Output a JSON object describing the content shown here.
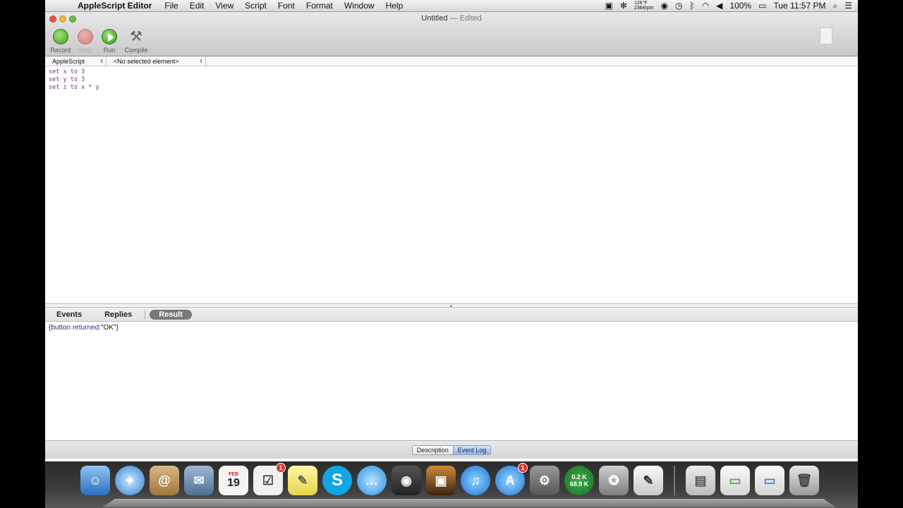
{
  "menubar": {
    "app_name": "AppleScript Editor",
    "menus": [
      "File",
      "Edit",
      "View",
      "Script",
      "Font",
      "Format",
      "Window",
      "Help"
    ],
    "temp_top": "126°F",
    "temp_bottom": "2364rpm",
    "battery": "100%",
    "clock": "Tue 11:57 PM"
  },
  "window": {
    "title": "Untitled",
    "title_suffix": "— Edited"
  },
  "toolbar": {
    "record_label": "Record",
    "stop_label": "Stop",
    "run_label": "Run",
    "compile_label": "Compile",
    "bundle_label": "Bundle Contents"
  },
  "navbar": {
    "language": "AppleScript",
    "element": "<No selected element>"
  },
  "editor": {
    "lines": [
      "set x to 3",
      "set y to 3",
      "set z to x * y"
    ]
  },
  "log_tabs": {
    "events": "Events",
    "replies": "Replies",
    "result": "Result"
  },
  "result": {
    "open": "{",
    "key": "button returned",
    "value": ":\"OK\"}"
  },
  "bottombar": {
    "description": "Description",
    "event_log": "Event Log"
  },
  "dock": {
    "calendar_day": "19",
    "calendar_month": "FEB",
    "app_store_badge": "1",
    "reminders_badge": "1",
    "net_up": "0.2 K",
    "net_down": "68.9 K"
  }
}
